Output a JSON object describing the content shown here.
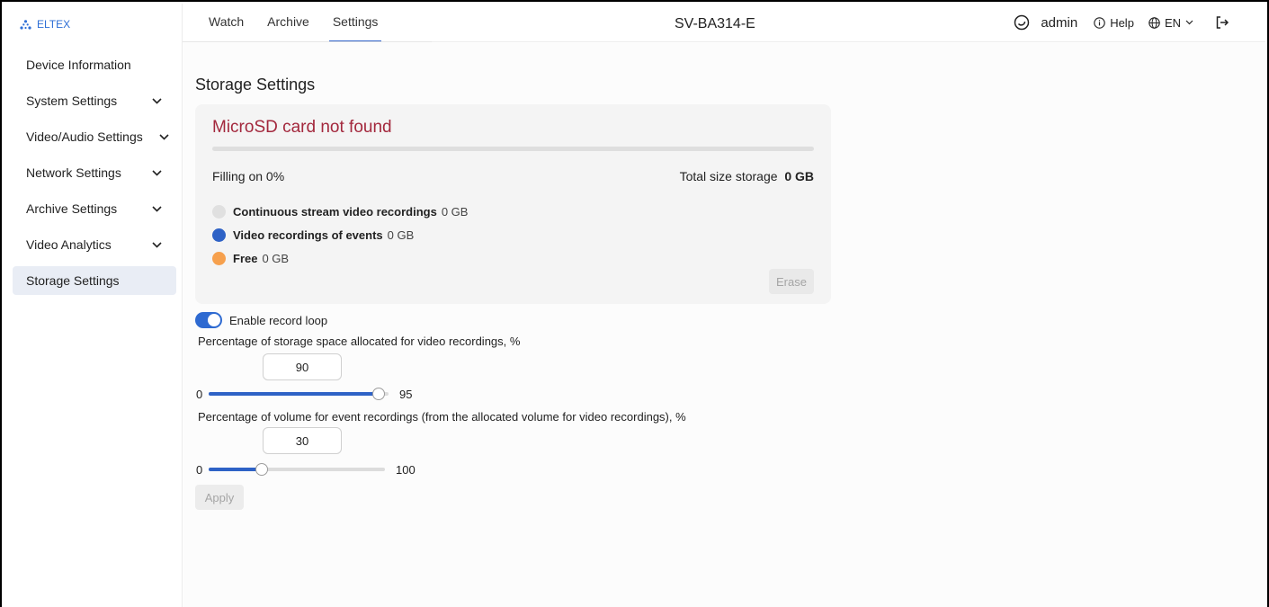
{
  "brand": {
    "logo_text": "ELTEX",
    "accent": "#2e6fd6"
  },
  "sidebar": {
    "items": [
      {
        "label": "Device Information",
        "expandable": false,
        "active": false
      },
      {
        "label": "System Settings",
        "expandable": true,
        "active": false
      },
      {
        "label": "Video/Audio Settings",
        "expandable": true,
        "active": false
      },
      {
        "label": "Network Settings",
        "expandable": true,
        "active": false
      },
      {
        "label": "Archive Settings",
        "expandable": true,
        "active": false
      },
      {
        "label": "Video Analytics",
        "expandable": true,
        "active": false
      },
      {
        "label": "Storage Settings",
        "expandable": false,
        "active": true
      }
    ]
  },
  "header": {
    "tabs": [
      {
        "label": "Watch",
        "active": false
      },
      {
        "label": "Archive",
        "active": false
      },
      {
        "label": "Settings",
        "active": true
      }
    ],
    "device_title": "SV-BA314-E",
    "theme_icon": "moon-icon",
    "user": "admin",
    "help_label": "Help",
    "lang_label": "EN",
    "logout_icon": "logout-icon"
  },
  "main": {
    "title": "Storage Settings",
    "card": {
      "status": "MicroSD card not found",
      "status_color": "#a3283d",
      "filling_label": "Filling on 0%",
      "total_label": "Total size storage",
      "total_value": "0 GB",
      "legend": [
        {
          "label": "Continuous stream video recordings",
          "value": "0 GB",
          "color": "#e0e0e0"
        },
        {
          "label": "Video recordings of events",
          "value": "0 GB",
          "color": "#2e62c6"
        },
        {
          "label": "Free",
          "value": "0 GB",
          "color": "#f6a04d"
        }
      ],
      "erase_label": "Erase"
    },
    "record_loop": {
      "label": "Enable record loop",
      "enabled": true
    },
    "storage_percent": {
      "label": "Percentage of storage space allocated for video recordings, %",
      "value": "90",
      "min": "0",
      "max": "95",
      "numeric": 90,
      "range": [
        0,
        95
      ]
    },
    "event_percent": {
      "label": "Percentage of volume for event recordings (from the allocated volume for video recordings), %",
      "value": "30",
      "min": "0",
      "max": "100",
      "numeric": 30,
      "range": [
        0,
        100
      ]
    },
    "apply_label": "Apply"
  }
}
